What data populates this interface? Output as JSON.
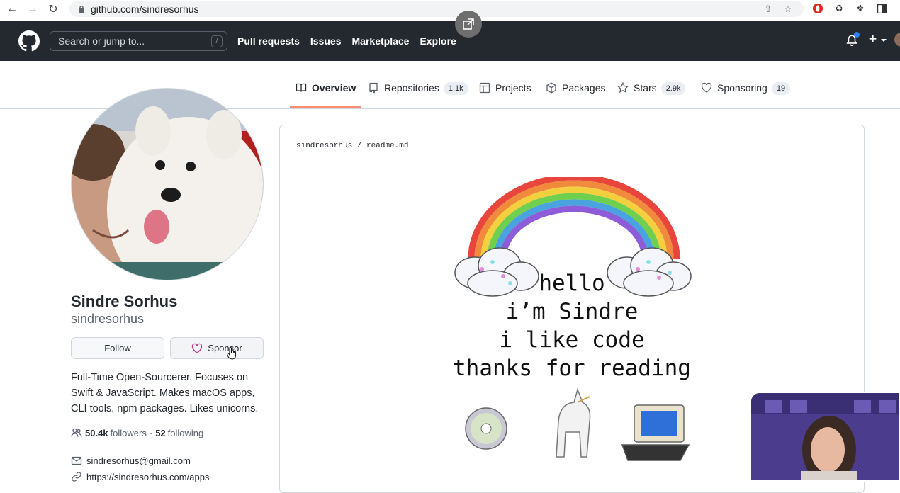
{
  "browser": {
    "url": "github.com/sindresorhus"
  },
  "header": {
    "search_placeholder": "Search or jump to...",
    "search_shortcut": "/",
    "nav": [
      "Pull requests",
      "Issues",
      "Marketplace",
      "Explore"
    ]
  },
  "tabs": [
    {
      "label": "Overview",
      "count": null,
      "icon": "book-icon",
      "selected": true
    },
    {
      "label": "Repositories",
      "count": "1.1k",
      "icon": "repo-icon",
      "selected": false
    },
    {
      "label": "Projects",
      "count": null,
      "icon": "table-icon",
      "selected": false
    },
    {
      "label": "Packages",
      "count": null,
      "icon": "package-icon",
      "selected": false
    },
    {
      "label": "Stars",
      "count": "2.9k",
      "icon": "star-icon",
      "selected": false
    },
    {
      "label": "Sponsoring",
      "count": "19",
      "icon": "heart-icon",
      "selected": false
    }
  ],
  "profile": {
    "full_name": "Sindre Sorhus",
    "username": "sindresorhus",
    "follow_label": "Follow",
    "sponsor_label": "Sponsor",
    "bio": "Full-Time Open-Sourcerer. Focuses on Swift & JavaScript. Makes macOS apps, CLI tools, npm packages. Likes unicorns.",
    "followers_count": "50.4k",
    "followers_label": "followers",
    "separator": "·",
    "following_count": "52",
    "following_label": "following",
    "email": "sindresorhus@gmail.com",
    "website": "https://sindresorhus.com/apps"
  },
  "readme": {
    "path_user": "sindresorhus",
    "path_sep": "/",
    "path_file": "readme.md",
    "lines": [
      "hello",
      "i’m Sindre",
      "i like code",
      "thanks for reading"
    ]
  },
  "colors": {
    "header_bg": "#24292f",
    "tab_underline": "#fd8c73",
    "notification_dot": "#2f81f7"
  }
}
